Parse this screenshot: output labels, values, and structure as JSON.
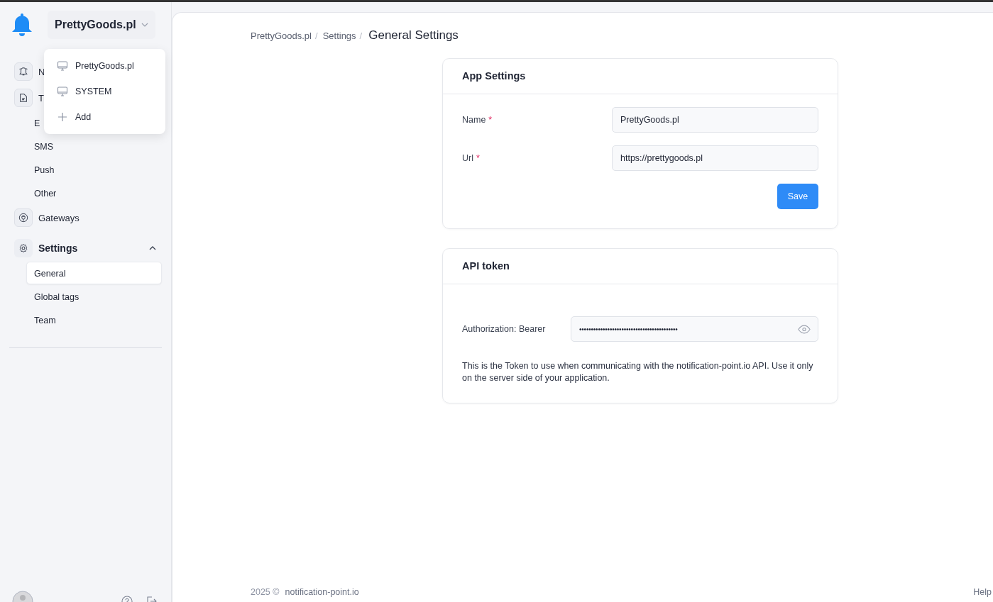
{
  "app_switcher": {
    "label": "PrettyGoods.pl",
    "expanded": true,
    "options": [
      {
        "label": "PrettyGoods.pl",
        "kind": "app"
      },
      {
        "label": "SYSTEM",
        "kind": "app"
      },
      {
        "label": "Add",
        "kind": "add"
      }
    ]
  },
  "sidebar": {
    "items": [
      {
        "label": "N"
      },
      {
        "label": "T",
        "children": [
          {
            "label": "E",
            "selected": false
          },
          {
            "label": "SMS",
            "selected": false
          },
          {
            "label": "Push",
            "selected": false
          },
          {
            "label": "Other",
            "selected": false
          }
        ]
      },
      {
        "label": "Gateways"
      },
      {
        "label": "Settings",
        "expanded": true,
        "children": [
          {
            "label": "General",
            "selected": true
          },
          {
            "label": "Global tags",
            "selected": false
          },
          {
            "label": "Team",
            "selected": false
          }
        ]
      }
    ]
  },
  "breadcrumb": [
    {
      "label": "PrettyGoods.pl",
      "separator": "/"
    },
    {
      "label": "Settings",
      "separator": "/"
    }
  ],
  "page_title": "General Settings",
  "app_settings": {
    "title": "App Settings",
    "fields": [
      {
        "label": "Name",
        "required_mark": "*",
        "value": "PrettyGoods.pl"
      },
      {
        "label": "Url",
        "required_mark": "*",
        "value": "https://prettygoods.pl"
      }
    ],
    "button": "Save"
  },
  "api_token": {
    "title": "API token",
    "label": "Authorization: Bearer",
    "value": "••••••••••••••••••••••••••••••••••••••••••",
    "note": "This is the Token to use when communicating with the notification-point.io API. Use it only on the server side of your application."
  },
  "footer": {
    "year": "2025 ©",
    "link": "notification-point.io",
    "help": "Help"
  }
}
